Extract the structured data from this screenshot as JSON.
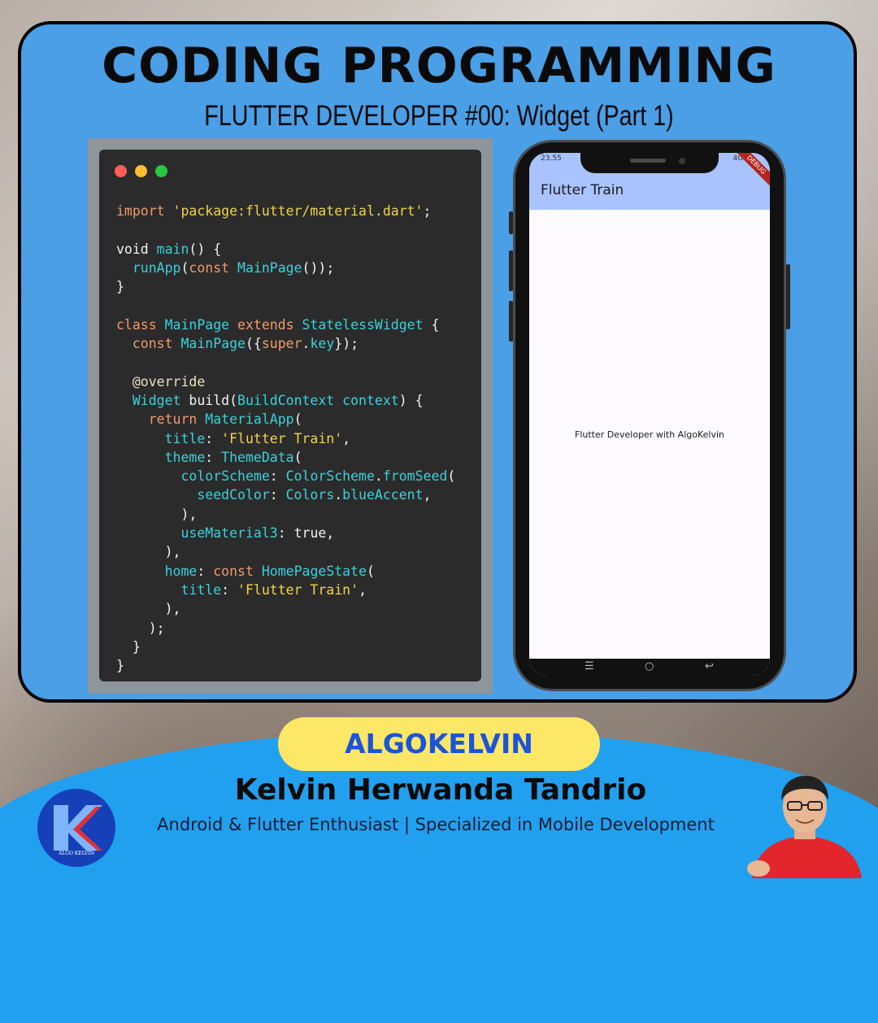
{
  "header": {
    "title": "CODING PROGRAMMING",
    "subtitle": "FLUTTER DEVELOPER #00: Widget (Part 1)"
  },
  "code_editor": {
    "lines": [
      [
        {
          "t": "import ",
          "c": "kw"
        },
        {
          "t": "'package:flutter/material.dart'",
          "c": "str"
        },
        {
          "t": ";",
          "c": "pl"
        }
      ],
      [],
      [
        {
          "t": "void ",
          "c": "pl"
        },
        {
          "t": "main",
          "c": "fn"
        },
        {
          "t": "() {",
          "c": "pl"
        }
      ],
      [
        {
          "t": "  ",
          "c": "pl"
        },
        {
          "t": "runApp",
          "c": "fn"
        },
        {
          "t": "(",
          "c": "pl"
        },
        {
          "t": "const ",
          "c": "kw"
        },
        {
          "t": "MainPage",
          "c": "ty"
        },
        {
          "t": "());",
          "c": "pl"
        }
      ],
      [
        {
          "t": "}",
          "c": "pl"
        }
      ],
      [],
      [
        {
          "t": "class ",
          "c": "kw"
        },
        {
          "t": "MainPage ",
          "c": "ty"
        },
        {
          "t": "extends ",
          "c": "kw"
        },
        {
          "t": "StatelessWidget",
          "c": "ty"
        },
        {
          "t": " {",
          "c": "pl"
        }
      ],
      [
        {
          "t": "  ",
          "c": "pl"
        },
        {
          "t": "const ",
          "c": "kw"
        },
        {
          "t": "MainPage",
          "c": "ty"
        },
        {
          "t": "({",
          "c": "pl"
        },
        {
          "t": "super",
          "c": "kw"
        },
        {
          "t": ".",
          "c": "pl"
        },
        {
          "t": "key",
          "c": "fn"
        },
        {
          "t": "});",
          "c": "pl"
        }
      ],
      [],
      [
        {
          "t": "  @override",
          "c": "an"
        }
      ],
      [
        {
          "t": "  ",
          "c": "pl"
        },
        {
          "t": "Widget ",
          "c": "ty"
        },
        {
          "t": "build",
          "c": "pl"
        },
        {
          "t": "(",
          "c": "pl"
        },
        {
          "t": "BuildContext ",
          "c": "ty"
        },
        {
          "t": "context",
          "c": "fn"
        },
        {
          "t": ") {",
          "c": "pl"
        }
      ],
      [
        {
          "t": "    ",
          "c": "pl"
        },
        {
          "t": "return ",
          "c": "kw"
        },
        {
          "t": "MaterialApp",
          "c": "ty"
        },
        {
          "t": "(",
          "c": "pl"
        }
      ],
      [
        {
          "t": "      ",
          "c": "pl"
        },
        {
          "t": "title",
          "c": "fn"
        },
        {
          "t": ": ",
          "c": "pl"
        },
        {
          "t": "'Flutter Train'",
          "c": "str"
        },
        {
          "t": ",",
          "c": "pl"
        }
      ],
      [
        {
          "t": "      ",
          "c": "pl"
        },
        {
          "t": "theme",
          "c": "fn"
        },
        {
          "t": ": ",
          "c": "pl"
        },
        {
          "t": "ThemeData",
          "c": "ty"
        },
        {
          "t": "(",
          "c": "pl"
        }
      ],
      [
        {
          "t": "        ",
          "c": "pl"
        },
        {
          "t": "colorScheme",
          "c": "fn"
        },
        {
          "t": ": ",
          "c": "pl"
        },
        {
          "t": "ColorScheme",
          "c": "ty"
        },
        {
          "t": ".",
          "c": "pl"
        },
        {
          "t": "fromSeed",
          "c": "fn"
        },
        {
          "t": "(",
          "c": "pl"
        }
      ],
      [
        {
          "t": "          ",
          "c": "pl"
        },
        {
          "t": "seedColor",
          "c": "fn"
        },
        {
          "t": ": ",
          "c": "pl"
        },
        {
          "t": "Colors",
          "c": "ty"
        },
        {
          "t": ".",
          "c": "pl"
        },
        {
          "t": "blueAccent",
          "c": "fn"
        },
        {
          "t": ",",
          "c": "pl"
        }
      ],
      [
        {
          "t": "        ),",
          "c": "pl"
        }
      ],
      [
        {
          "t": "        ",
          "c": "pl"
        },
        {
          "t": "useMaterial3",
          "c": "fn"
        },
        {
          "t": ": true,",
          "c": "pl"
        }
      ],
      [
        {
          "t": "      ),",
          "c": "pl"
        }
      ],
      [
        {
          "t": "      ",
          "c": "pl"
        },
        {
          "t": "home",
          "c": "fn"
        },
        {
          "t": ": ",
          "c": "pl"
        },
        {
          "t": "const ",
          "c": "kw"
        },
        {
          "t": "HomePageState",
          "c": "ty"
        },
        {
          "t": "(",
          "c": "pl"
        }
      ],
      [
        {
          "t": "        ",
          "c": "pl"
        },
        {
          "t": "title",
          "c": "fn"
        },
        {
          "t": ": ",
          "c": "pl"
        },
        {
          "t": "'Flutter Train'",
          "c": "str"
        },
        {
          "t": ",",
          "c": "pl"
        }
      ],
      [
        {
          "t": "      ),",
          "c": "pl"
        }
      ],
      [
        {
          "t": "    );",
          "c": "pl"
        }
      ],
      [
        {
          "t": "  }",
          "c": "pl"
        }
      ],
      [
        {
          "t": "}",
          "c": "pl"
        }
      ]
    ]
  },
  "phone": {
    "status_time": "23.55",
    "status_right": "4G ▮▮",
    "debug_label": "DEBUG",
    "appbar_title": "Flutter Train",
    "body_text": "Flutter Developer with AlgoKelvin",
    "nav": {
      "menu": "☰",
      "home": "○",
      "back": "↩"
    }
  },
  "footer": {
    "brand": "ALGOKELVIN",
    "name": "Kelvin Herwanda Tandrio",
    "tagline": "Android & Flutter Enthusiast | Specialized in Mobile Development",
    "logo_caption": "ALGO KELVIN"
  },
  "colors": {
    "card": "#4a9fe6",
    "panel": "#22a0f0",
    "pill": "#fde767",
    "brand_text": "#1a55d8",
    "code_bg": "#2b2b2b",
    "appbar": "#a9c3ff"
  }
}
